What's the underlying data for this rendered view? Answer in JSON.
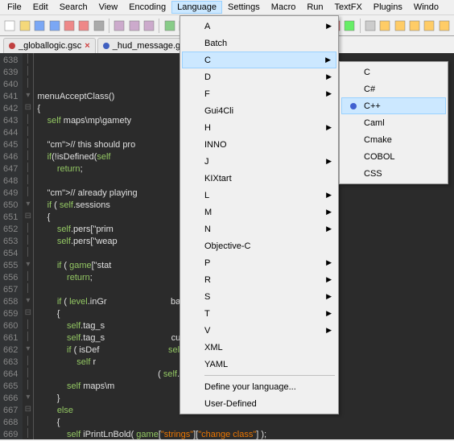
{
  "menubar": [
    "File",
    "Edit",
    "Search",
    "View",
    "Encoding",
    "Language",
    "Settings",
    "Macro",
    "Run",
    "TextFX",
    "Plugins",
    "Windo"
  ],
  "menubar_open_index": 5,
  "tabs": [
    {
      "label": "_globallogic.gsc",
      "active": true
    },
    {
      "label": "_hud_message.g",
      "active": false
    }
  ],
  "gutter_start": 638,
  "gutter_end": 669,
  "fold_marks": {
    "641": "-",
    "642": "⊟",
    "650": "-",
    "651": "⊟",
    "655": "-",
    "658": "-",
    "659": "⊟",
    "662": "-",
    "666": "-",
    "667": "⊟"
  },
  "code_lines": [
    "",
    "",
    "",
    "menuAcceptClass()",
    "{",
    "    self maps\\mp\\gamety",
    "",
    "    // this should pro",
    "    if(!isDefined(self",
    "        return;",
    "",
    "    // already playing",
    "    if ( self.sessions",
    "    {",
    "        self.pers[\"prim",
    "        self.pers[\"weap",
    "",
    "        if ( game[\"stat",
    "            return;",
    "",
    "        if ( level.inGr                          bat ) // used weapon",
    "        {",
    "            self.tag_s",
    "            self.tag_s                           curClass != self.cla",
    "            if ( isDef                            self.curClass );",
    "                self r",
    "                                                 ( self.pers[\"team\"",
    "            self maps\\m",
    "        }",
    "        else",
    "        {",
    "            self iPrintLnBold( game[\"strings\"][\"change class\"] );"
  ],
  "menu1": [
    {
      "label": "A",
      "sub": true
    },
    {
      "label": "Batch"
    },
    {
      "label": "C",
      "sub": true,
      "hover": true
    },
    {
      "label": "D",
      "sub": true
    },
    {
      "label": "F",
      "sub": true
    },
    {
      "label": "Gui4Cli"
    },
    {
      "label": "H",
      "sub": true
    },
    {
      "label": "INNO"
    },
    {
      "label": "J",
      "sub": true
    },
    {
      "label": "KIXtart"
    },
    {
      "label": "L",
      "sub": true
    },
    {
      "label": "M",
      "sub": true
    },
    {
      "label": "N",
      "sub": true
    },
    {
      "label": "Objective-C"
    },
    {
      "label": "P",
      "sub": true
    },
    {
      "label": "R",
      "sub": true
    },
    {
      "label": "S",
      "sub": true
    },
    {
      "label": "T",
      "sub": true
    },
    {
      "label": "V",
      "sub": true
    },
    {
      "label": "XML"
    },
    {
      "label": "YAML"
    },
    {
      "sep": true
    },
    {
      "label": "Define your language..."
    },
    {
      "label": "User-Defined"
    }
  ],
  "menu2": [
    {
      "label": "C"
    },
    {
      "label": "C#"
    },
    {
      "label": "C++",
      "hover": true,
      "icon": "#4060d0"
    },
    {
      "label": "Caml"
    },
    {
      "label": "Cmake"
    },
    {
      "label": "COBOL"
    },
    {
      "label": "CSS"
    }
  ],
  "toolbar_icons": [
    "new",
    "open",
    "save",
    "saveall",
    "close",
    "closeall",
    "print",
    "",
    "cut",
    "copy",
    "paste",
    "",
    "undo",
    "redo",
    "",
    "find",
    "replace",
    "",
    "zoom",
    "wrap",
    "chars",
    "indent",
    "fold",
    "wrap2",
    "",
    "rec",
    "play",
    "",
    "spacer",
    "h1",
    "h2",
    "h3",
    "h4",
    "h5"
  ]
}
